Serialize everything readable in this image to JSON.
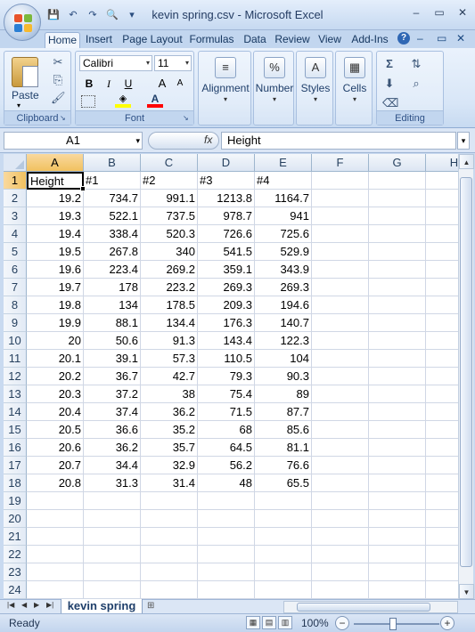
{
  "window": {
    "title": "kevin spring.csv - Microsoft Excel",
    "minimize": "–",
    "maximize": "▭",
    "close": "✕"
  },
  "qat": {
    "save": "💾",
    "undo": "↶",
    "redo": "↷",
    "preview": "🔍",
    "customize": "▾"
  },
  "ribbon": {
    "tabs": [
      "Home",
      "Insert",
      "Page Layout",
      "Formulas",
      "Data",
      "Review",
      "View",
      "Add-Ins"
    ],
    "active_tab": "Home",
    "help": "?",
    "groups": {
      "clipboard": {
        "label": "Clipboard",
        "paste": "Paste"
      },
      "font": {
        "label": "Font",
        "font_name": "Calibri",
        "font_size": "11",
        "bold": "B",
        "italic": "I",
        "underline": "U",
        "grow": "A",
        "shrink": "A"
      },
      "alignment": {
        "label": "Alignment"
      },
      "number": {
        "label": "Number",
        "icon": "%"
      },
      "styles": {
        "label": "Styles"
      },
      "cells": {
        "label": "Cells"
      },
      "editing": {
        "label": "Editing",
        "sum": "Σ"
      }
    },
    "colors": {
      "highlight": "#ffff00",
      "font_color": "#ff0000"
    }
  },
  "formula_bar": {
    "name_box": "A1",
    "fx": "fx",
    "value": "Height"
  },
  "grid": {
    "columns": [
      "A",
      "B",
      "C",
      "D",
      "E",
      "F",
      "G",
      "H"
    ],
    "selected_column": "A",
    "selected_row": "1",
    "active_cell": "A1",
    "row_numbers": [
      "1",
      "2",
      "3",
      "4",
      "5",
      "6",
      "7",
      "8",
      "9",
      "10",
      "11",
      "12",
      "13",
      "14",
      "15",
      "16",
      "17",
      "18",
      "19",
      "20",
      "21",
      "22",
      "23",
      "24"
    ],
    "rows": [
      [
        "Height",
        "#1",
        "#2",
        "#3",
        "#4"
      ],
      [
        "19.2",
        "734.7",
        "991.1",
        "1213.8",
        "1164.7"
      ],
      [
        "19.3",
        "522.1",
        "737.5",
        "978.7",
        "941"
      ],
      [
        "19.4",
        "338.4",
        "520.3",
        "726.6",
        "725.6"
      ],
      [
        "19.5",
        "267.8",
        "340",
        "541.5",
        "529.9"
      ],
      [
        "19.6",
        "223.4",
        "269.2",
        "359.1",
        "343.9"
      ],
      [
        "19.7",
        "178",
        "223.2",
        "269.3",
        "269.3"
      ],
      [
        "19.8",
        "134",
        "178.5",
        "209.3",
        "194.6"
      ],
      [
        "19.9",
        "88.1",
        "134.4",
        "176.3",
        "140.7"
      ],
      [
        "20",
        "50.6",
        "91.3",
        "143.4",
        "122.3"
      ],
      [
        "20.1",
        "39.1",
        "57.3",
        "110.5",
        "104"
      ],
      [
        "20.2",
        "36.7",
        "42.7",
        "79.3",
        "90.3"
      ],
      [
        "20.3",
        "37.2",
        "38",
        "75.4",
        "89"
      ],
      [
        "20.4",
        "37.4",
        "36.2",
        "71.5",
        "87.7"
      ],
      [
        "20.5",
        "36.6",
        "35.2",
        "68",
        "85.6"
      ],
      [
        "20.6",
        "36.2",
        "35.7",
        "64.5",
        "81.1"
      ],
      [
        "20.7",
        "34.4",
        "32.9",
        "56.2",
        "76.6"
      ],
      [
        "20.8",
        "31.3",
        "31.4",
        "48",
        "65.5"
      ]
    ]
  },
  "sheets": {
    "tabs": [
      "kevin spring"
    ],
    "active": "kevin spring"
  },
  "status": {
    "text": "Ready",
    "zoom": "100%"
  }
}
